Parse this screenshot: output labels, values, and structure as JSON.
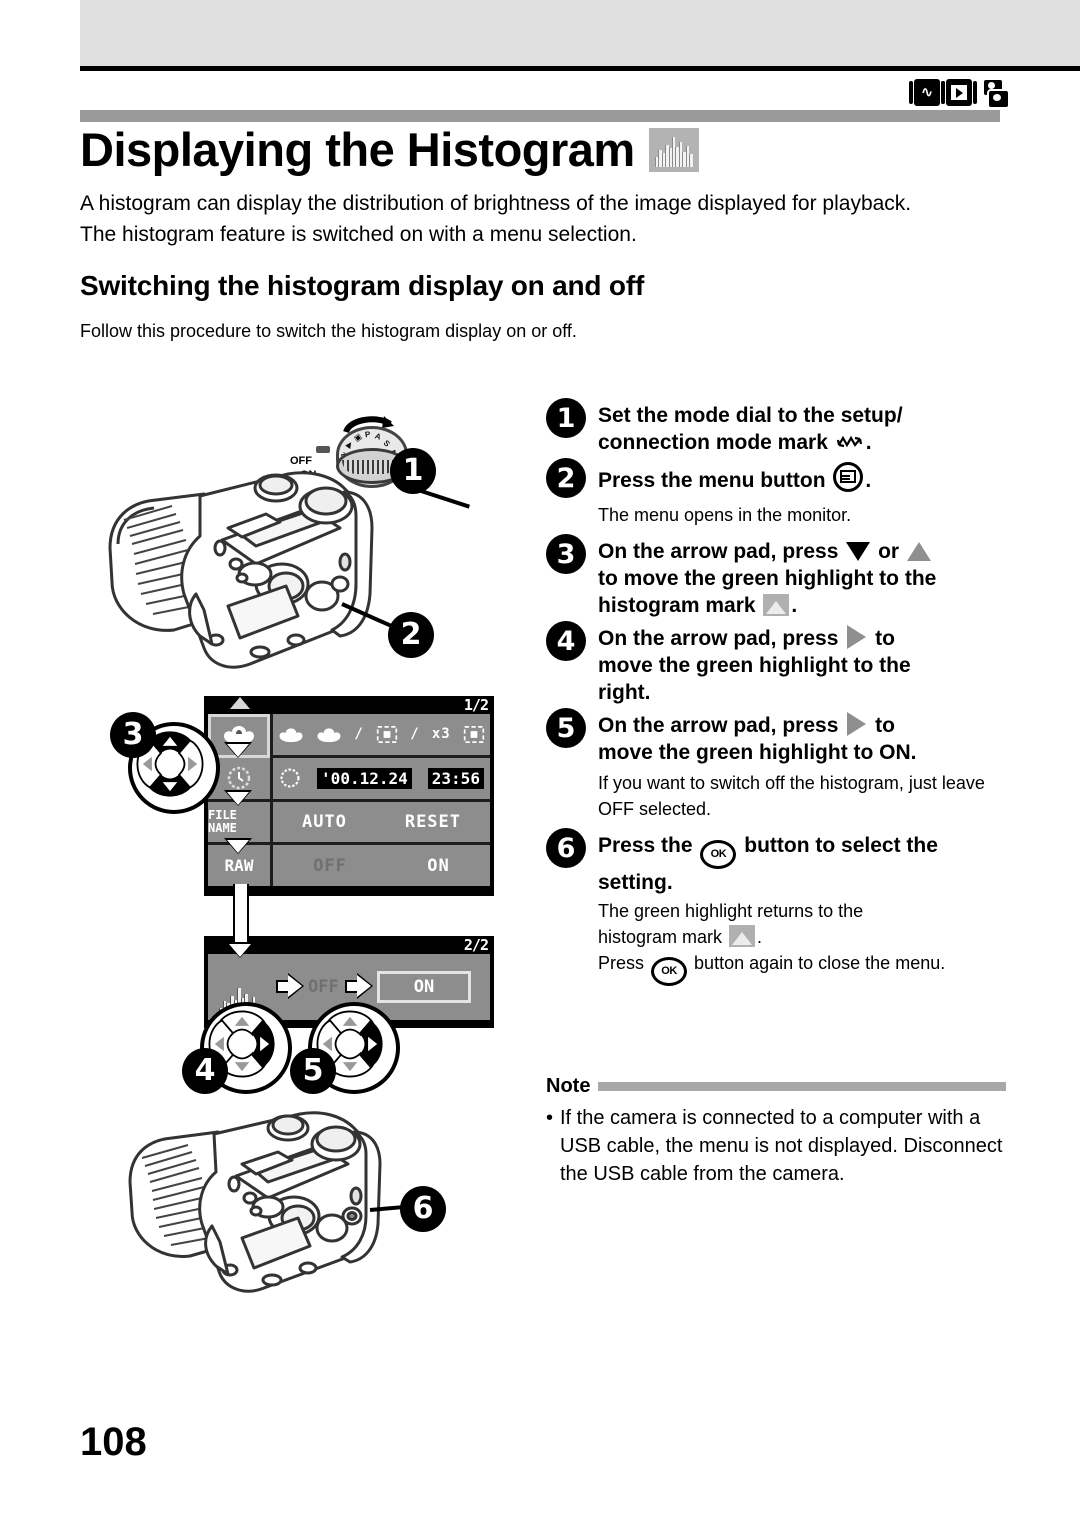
{
  "page": {
    "number": "108",
    "title": "Displaying the Histogram",
    "title_icon": "histogram-icon",
    "mode_icons": [
      "setup-connection-mode-icon",
      "playback-mode-icon",
      "card-setup-mode-icon"
    ]
  },
  "intro": "A histogram can display the distribution of brightness of the image displayed for playback. The histogram feature is switched on with a menu selection.",
  "subhead": "Switching the histogram display on and off",
  "subintro": "Follow this procedure to switch the histogram display on or off.",
  "steps": [
    {
      "number": "1",
      "parts": [
        "Set the mode dial to the setup/ connection mode mark ",
        "setup-mark-icon",
        "."
      ]
    },
    {
      "number": "2",
      "parts": [
        "Press the menu button ",
        "menu-button-icon",
        "."
      ],
      "sub": "The menu opens in the monitor."
    },
    {
      "number": "3",
      "parts": [
        "On the arrow pad, press ",
        "triangle-down-icon",
        " or ",
        "triangle-up-icon",
        " to move the green highlight to the histogram mark ",
        "histogram-mark-icon",
        "."
      ]
    },
    {
      "number": "4",
      "parts": [
        "On the arrow pad, press ",
        "triangle-right-icon",
        " to move the green highlight to the right."
      ]
    },
    {
      "number": "5",
      "parts": [
        "On the arrow pad, press ",
        "triangle-right-icon",
        " to move the green highlight to ON."
      ],
      "sub": "If you want to switch off the histogram, just leave OFF selected."
    },
    {
      "number": "6",
      "parts": [
        "Press the ",
        "ok-button-icon",
        " button to select the setting."
      ],
      "sub": "The green highlight returns to the histogram mark ",
      "sub_tail": ".",
      "sub2_pre": "Press ",
      "sub2_post": " button again to close the menu."
    }
  ],
  "step_labels": {
    "s1a": "Set the mode dial to the setup/",
    "s1b": "connection mode mark",
    "s2a": "Press the menu button",
    "s2_sub": "The menu opens in the monitor.",
    "s3a": "On the arrow pad, press",
    "s3b": "or",
    "s3c": "to move the green highlight to the",
    "s3d": "histogram mark",
    "s4a": "On the arrow pad, press",
    "s4b": "to",
    "s4c": "move the green highlight to the",
    "s4d": "right.",
    "s5a": "On the arrow pad, press",
    "s5b": "to",
    "s5c": "move the green highlight to ON.",
    "s5_sub": "If you want to switch off the histogram, just leave OFF selected.",
    "s6a": "Press the",
    "s6b": "button to select the",
    "s6c": "setting.",
    "s6_sub1a": "The green highlight returns to the",
    "s6_sub1b": "histogram mark",
    "s6_sub2a": "Press",
    "s6_sub2b": "button again to close the menu."
  },
  "note": {
    "label": "Note",
    "bullet": "•",
    "text": "If the camera is connected to a computer with a USB cable, the menu is not displayed. Disconnect the USB cable from the camera."
  },
  "illustration": {
    "callouts": [
      "1",
      "2",
      "3",
      "4",
      "5",
      "6"
    ],
    "mode_dial": {
      "off_label": "OFF",
      "on_label": "ON",
      "positions": [
        "M",
        "A",
        "S",
        "P",
        "⌘",
        "▶",
        "∿"
      ]
    },
    "lcd_screen_1": {
      "page_indicator": "1/2",
      "rows": [
        {
          "left_icon": "macro-icon",
          "values": [
            "macro-icon",
            "macro-icon",
            "/",
            "spot-icon",
            "/",
            "x3",
            "spot-icon"
          ],
          "selected": true
        },
        {
          "left_icon": "clock-icon",
          "values": [
            "'00.12.24",
            "23:56"
          ]
        },
        {
          "left_label": "FILE NAME",
          "values": [
            "AUTO",
            "RESET"
          ]
        },
        {
          "left_label": "RAW",
          "values": [
            "OFF",
            "ON"
          ]
        }
      ]
    },
    "lcd_screen_2": {
      "page_indicator": "2/2",
      "row": {
        "left_icon": "histogram-icon",
        "off_label": "OFF",
        "on_label": "ON",
        "on_selected": true
      }
    },
    "arrow_pads": [
      {
        "callout": "3",
        "active": [
          "up",
          "down"
        ]
      },
      {
        "callout": "4",
        "active": [
          "right"
        ]
      },
      {
        "callout": "5",
        "active": [
          "right"
        ]
      }
    ]
  }
}
